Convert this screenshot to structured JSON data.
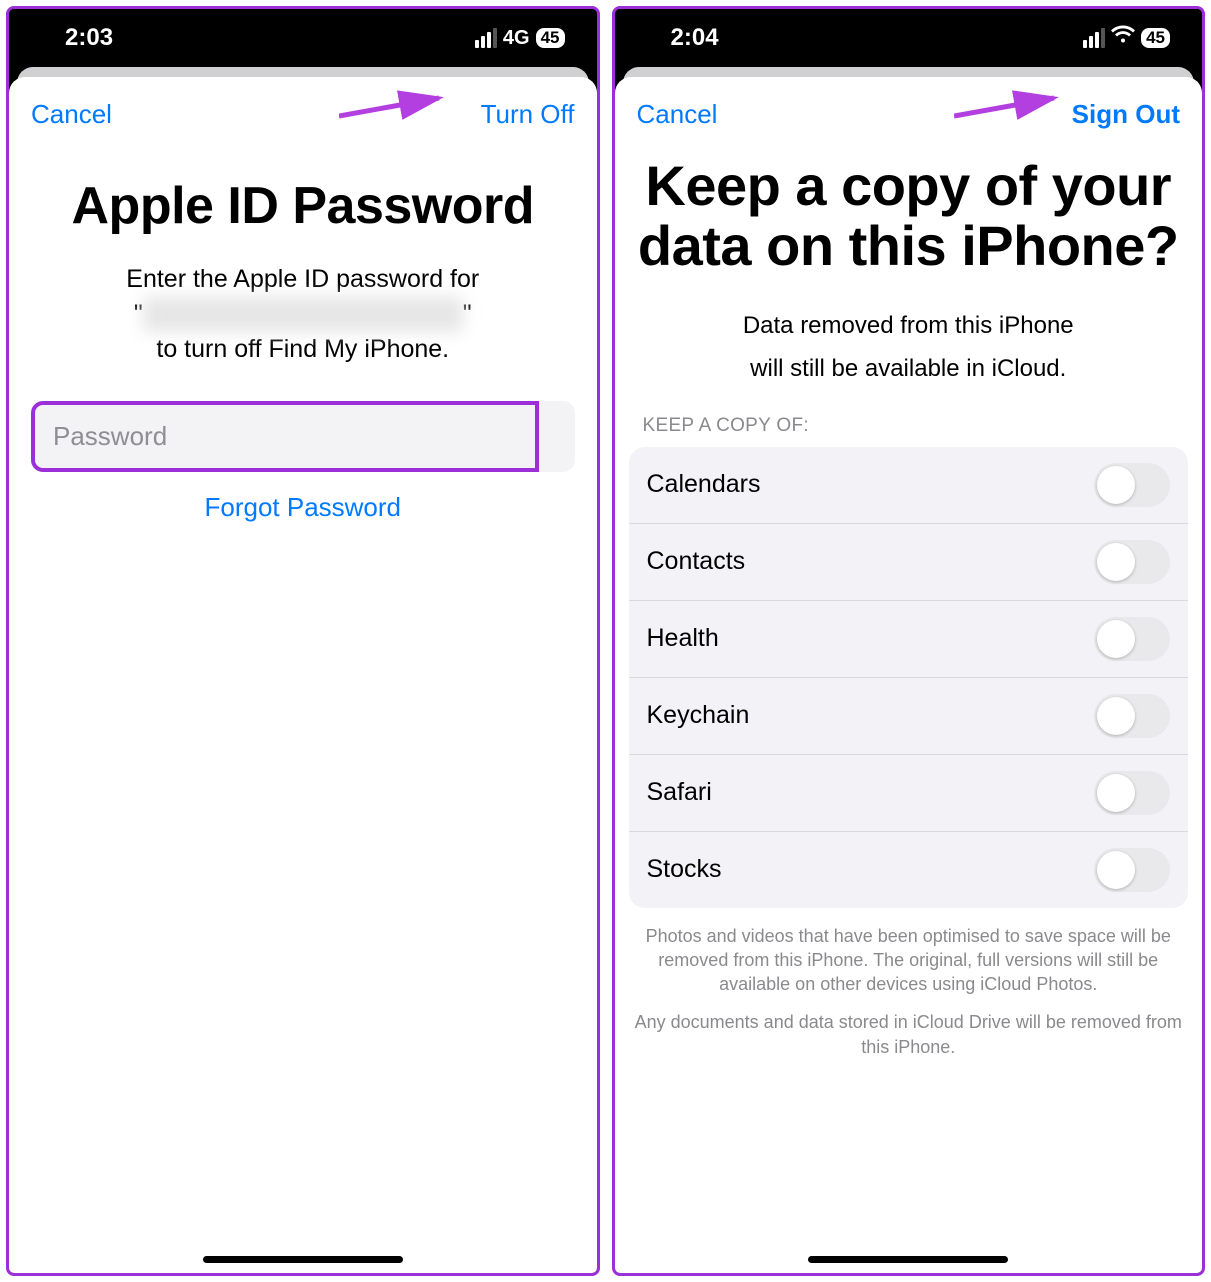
{
  "left": {
    "status": {
      "time": "2:03",
      "network": "4G",
      "battery": "45"
    },
    "nav": {
      "cancel": "Cancel",
      "action": "Turn Off"
    },
    "title": "Apple ID Password",
    "subtitle_pre": "Enter the Apple ID password for",
    "subtitle_post": "to turn off Find My iPhone.",
    "password_placeholder": "Password",
    "forgot": "Forgot Password"
  },
  "right": {
    "status": {
      "time": "2:04",
      "battery": "45"
    },
    "nav": {
      "cancel": "Cancel",
      "action": "Sign Out"
    },
    "title": "Keep a copy of your data on this iPhone?",
    "desc1": "Data removed from this iPhone",
    "desc2": "will still be available in iCloud.",
    "section": "KEEP A COPY OF:",
    "items": [
      {
        "label": "Calendars"
      },
      {
        "label": "Contacts"
      },
      {
        "label": "Health"
      },
      {
        "label": "Keychain"
      },
      {
        "label": "Safari"
      },
      {
        "label": "Stocks"
      }
    ],
    "footnote1": "Photos and videos that have been optimised to save space will be removed from this iPhone. The original, full versions will still be available on other devices using iCloud Photos.",
    "footnote2": "Any documents and data stored in iCloud Drive will be removed from this iPhone."
  }
}
